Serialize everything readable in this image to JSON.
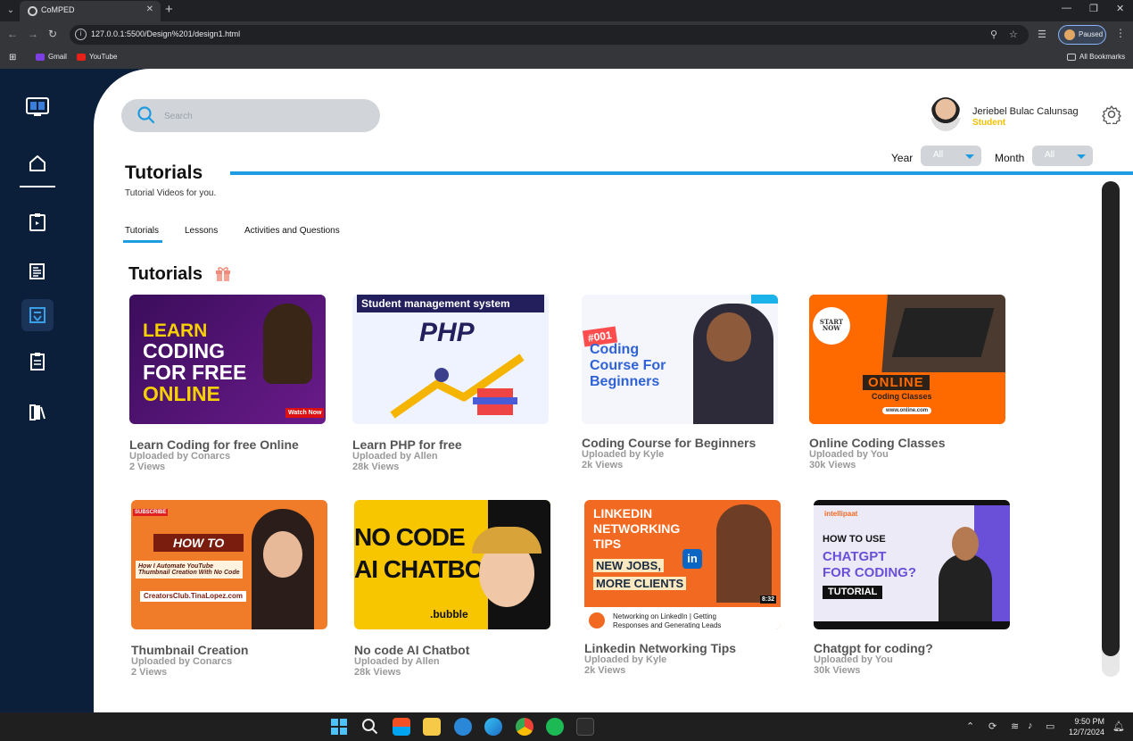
{
  "browser": {
    "tab_title": "CoMPED",
    "url": "127.0.0.1:5500/Design%201/design1.html",
    "paused_label": "Paused",
    "bookmarks": [
      "Gmail",
      "YouTube"
    ],
    "all_bookmarks": "All Bookmarks"
  },
  "sidebar": {
    "items": [
      "logo-icon",
      "home-icon",
      "assignment-icon",
      "news-icon",
      "tutorials-icon",
      "clipboard-icon",
      "library-icon"
    ],
    "active": "tutorials-icon"
  },
  "header": {
    "search_placeholder": "Search",
    "user_name": "Jeriebel Bulac Calunsag",
    "user_role": "Student",
    "filters": {
      "year_label": "Year",
      "year_value": "All",
      "month_label": "Month",
      "month_value": "All"
    }
  },
  "page": {
    "title": "Tutorials",
    "subtitle": "Tutorial Videos for you.",
    "tabs": [
      "Tutorials",
      "Lessons",
      "Activities and Questions"
    ],
    "active_tab": "Tutorials",
    "section_title": "Tutorials"
  },
  "videos": [
    {
      "title": "Learn Coding for free Online",
      "uploader": "Uploaded by Conarcs",
      "views": "2 Views",
      "thumb": [
        "LEARN",
        "CODING",
        "FOR FREE",
        "ONLINE"
      ],
      "badge": "Watch Now"
    },
    {
      "title": "Learn PHP for free",
      "uploader": "Uploaded by Allen",
      "views": "28k Views",
      "thumb": [
        "Student management system",
        "PHP"
      ]
    },
    {
      "title": "Coding Course for Beginners",
      "uploader": "Uploaded by Kyle",
      "views": "2k Views",
      "thumb": [
        "#001",
        "Coding",
        "Course For",
        "Beginners"
      ]
    },
    {
      "title": "Online Coding Classes",
      "uploader": "Uploaded by You",
      "views": "30k Views",
      "thumb": [
        "START NOW",
        "ONLINE",
        "Coding Classes",
        "www.online.com"
      ]
    },
    {
      "title": "Thumbnail Creation",
      "uploader": "Uploaded by Conarcs",
      "views": "2 Views",
      "thumb": [
        "SUBSCRIBE",
        "HOW TO",
        "How I Automate YouTube Thumbnail Creation With No Code",
        "CreatorsClub.TinaLopez.com"
      ]
    },
    {
      "title": "No code AI Chatbot",
      "uploader": "Uploaded by Allen",
      "views": "28k Views",
      "thumb": [
        "NO CODE",
        "AI CHATBOT",
        ".bubble"
      ]
    },
    {
      "title": "Linkedin Networking Tips",
      "uploader": "Uploaded by Kyle",
      "views": "2k Views",
      "thumb": [
        "LINKEDIN",
        "NETWORKING",
        "TIPS",
        "NEW JOBS,",
        "MORE CLIENTS",
        "8:32",
        "Networking on LinkedIn | Getting Responses and Generating Leads"
      ]
    },
    {
      "title": "Chatgpt for coding?",
      "uploader": "Uploaded by You",
      "views": "30k Views",
      "thumb": [
        "intellipaat",
        "HOW TO USE",
        "CHATGPT",
        "FOR CODING?",
        "TUTORIAL"
      ]
    }
  ],
  "taskbar": {
    "time": "9:50 PM",
    "date": "12/7/2024"
  },
  "colors": {
    "sidebar_bg": "#0b1f3a",
    "accent": "#1e9de3",
    "role": "#f2c000"
  }
}
